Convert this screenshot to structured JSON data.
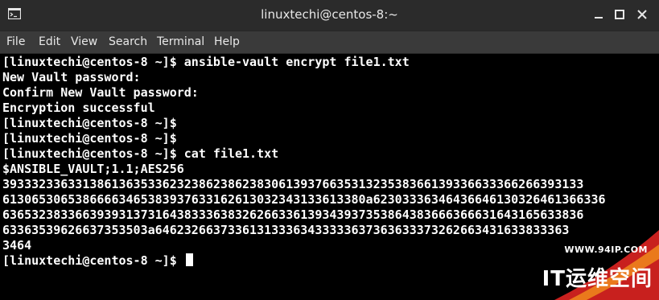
{
  "window": {
    "title": "linuxtechi@centos-8:~"
  },
  "menubar": {
    "items": [
      "File",
      "Edit",
      "View",
      "Search",
      "Terminal",
      "Help"
    ]
  },
  "terminal": {
    "lines": [
      "[linuxtechi@centos-8 ~]$ ansible-vault encrypt file1.txt",
      "New Vault password:",
      "Confirm New Vault password:",
      "Encryption successful",
      "[linuxtechi@centos-8 ~]$",
      "[linuxtechi@centos-8 ~]$",
      "[linuxtechi@centos-8 ~]$ cat file1.txt",
      "$ANSIBLE_VAULT;1.1;AES256",
      "39333233633138613635336232386238623830613937663531323538366139336633366266393133",
      "61306530653866663465383937633162613032343133613380a62303336346436646130326461366336",
      "63653238336639393137316438333638326266336139343937353864383666366631643165633836",
      "63363539626637353503a646232663733613133363433333637363633373262663431633833363",
      "3464"
    ],
    "prompt": "[linuxtechi@centos-8 ~]$"
  },
  "watermark": {
    "url": "WWW.94IP.COM",
    "brand": "IT运维空间"
  },
  "colors": {
    "titlebar": "#2b2b2b",
    "menubar": "#3a3a3a",
    "terminal_bg": "#000000",
    "terminal_fg": "#ffffff",
    "watermark_red": "#c8201e",
    "watermark_orange": "#f08a1c"
  }
}
